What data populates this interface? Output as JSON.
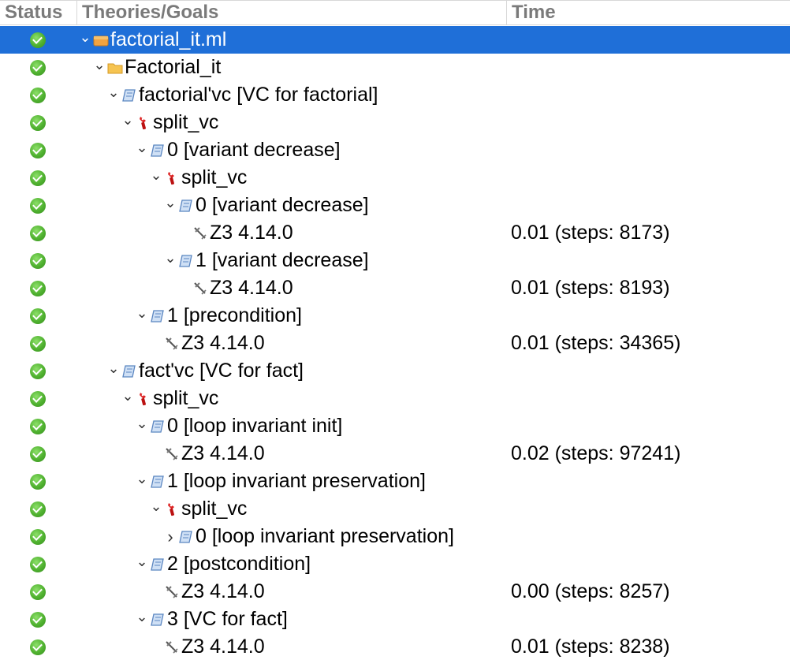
{
  "header": {
    "status": "Status",
    "goals": "Theories/Goals",
    "time": "Time"
  },
  "rows": [
    {
      "label": "factorial_it.ml",
      "time": "",
      "icon": "file",
      "chevron": "expanded"
    },
    {
      "label": "Factorial_it",
      "time": "",
      "icon": "theory",
      "chevron": "expanded"
    },
    {
      "label": "factorial'vc [VC for factorial]",
      "time": "",
      "icon": "goal",
      "chevron": "expanded"
    },
    {
      "label": "split_vc",
      "time": "",
      "icon": "transformation",
      "chevron": "expanded"
    },
    {
      "label": "0 [variant decrease]",
      "time": "",
      "icon": "goal",
      "chevron": "expanded"
    },
    {
      "label": "split_vc",
      "time": "",
      "icon": "transformation",
      "chevron": "expanded"
    },
    {
      "label": "0 [variant decrease]",
      "time": "",
      "icon": "goal",
      "chevron": "expanded"
    },
    {
      "label": "Z3 4.14.0",
      "time": "0.01 (steps: 8173)",
      "icon": "prover",
      "chevron": "none"
    },
    {
      "label": "1 [variant decrease]",
      "time": "",
      "icon": "goal",
      "chevron": "expanded"
    },
    {
      "label": "Z3 4.14.0",
      "time": "0.01 (steps: 8193)",
      "icon": "prover",
      "chevron": "none"
    },
    {
      "label": "1 [precondition]",
      "time": "",
      "icon": "goal",
      "chevron": "expanded"
    },
    {
      "label": "Z3 4.14.0",
      "time": "0.01 (steps: 34365)",
      "icon": "prover",
      "chevron": "none"
    },
    {
      "label": "fact'vc [VC for fact]",
      "time": "",
      "icon": "goal",
      "chevron": "expanded"
    },
    {
      "label": "split_vc",
      "time": "",
      "icon": "transformation",
      "chevron": "expanded"
    },
    {
      "label": "0 [loop invariant init]",
      "time": "",
      "icon": "goal",
      "chevron": "expanded"
    },
    {
      "label": "Z3 4.14.0",
      "time": "0.02 (steps: 97241)",
      "icon": "prover",
      "chevron": "none"
    },
    {
      "label": "1 [loop invariant preservation]",
      "time": "",
      "icon": "goal",
      "chevron": "expanded"
    },
    {
      "label": "split_vc",
      "time": "",
      "icon": "transformation",
      "chevron": "expanded"
    },
    {
      "label": "0 [loop invariant preservation]",
      "time": "",
      "icon": "goal",
      "chevron": "collapsed"
    },
    {
      "label": "2 [postcondition]",
      "time": "",
      "icon": "goal",
      "chevron": "expanded"
    },
    {
      "label": "Z3 4.14.0",
      "time": "0.00 (steps: 8257)",
      "icon": "prover",
      "chevron": "none"
    },
    {
      "label": "3 [VC for fact]",
      "time": "",
      "icon": "goal",
      "chevron": "expanded"
    },
    {
      "label": "Z3 4.14.0",
      "time": "0.01 (steps: 8238)",
      "icon": "prover",
      "chevron": "none"
    }
  ],
  "colors": {
    "selection": "#1f6fd8",
    "status_ok": "#4fb12f"
  }
}
